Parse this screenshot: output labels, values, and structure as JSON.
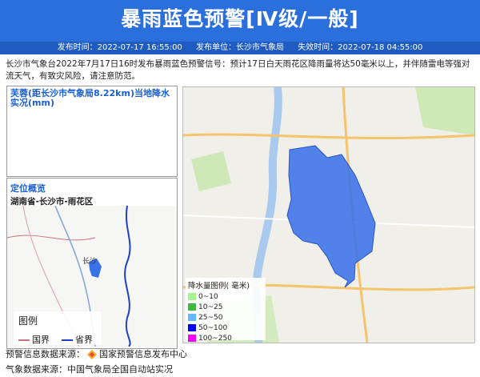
{
  "header": {
    "title": "暴雨蓝色预警[Ⅳ级/一般]"
  },
  "meta": {
    "publish_time": "发布时间：2022-07-17 16:55:00",
    "publisher": "发布单位：长沙市气象局",
    "expire_time": "失效时间：2022-07-18 04:55:00"
  },
  "description": "长沙市气象台2022年7月17日16时发布暴雨蓝色预警信号：预计17日白天雨花区降雨量将达50毫米以上，并伴随雷电等强对流天气，有致灾风险，请注意防范。",
  "station_panel": {
    "title": "芙蓉(距长沙市气象局8.22km)当地降水实况(mm)"
  },
  "location_panel": {
    "title": "定位概览",
    "region": "湖南省-长沙市-雨花区",
    "map_label": "长沙",
    "legend": {
      "title": "图例",
      "items": [
        {
          "label": "国界",
          "color": "#c9737a"
        },
        {
          "label": "省界",
          "color": "#1e3fc8"
        }
      ]
    }
  },
  "rain_legend": {
    "title": "降水量图例( 毫米)",
    "items": [
      {
        "label": "0~10",
        "color": "#a6f28f"
      },
      {
        "label": "10~25",
        "color": "#3dba3d"
      },
      {
        "label": "25~50",
        "color": "#61b8ff"
      },
      {
        "label": "50~100",
        "color": "#0000ff"
      },
      {
        "label": "100~250",
        "color": "#fa00fa"
      }
    ]
  },
  "footer": {
    "source1_label": "预警信息数据来源：",
    "source1_value": "国家预警信息发布中心",
    "source2": "气象数据来源：中国气象局全国自动站实况"
  },
  "colors": {
    "banner": "#2a6fdc",
    "meta_bar": "#1f5cc2",
    "accent": "#1a5fd6",
    "warning_area": "#3a72e8"
  }
}
